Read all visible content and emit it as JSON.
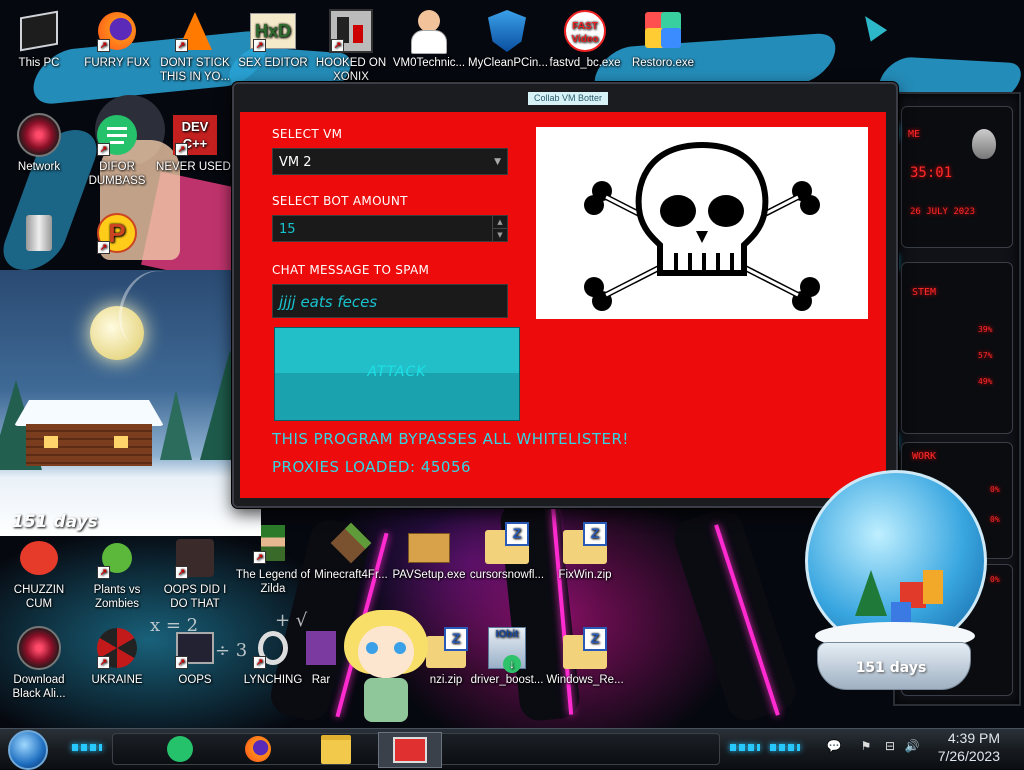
{
  "desktop_icons": [
    {
      "name": "icon-this-pc",
      "label": "This PC"
    },
    {
      "name": "icon-furry-fux",
      "label": "FURRY FUX"
    },
    {
      "name": "icon-dont-stick",
      "label": "DONT STICK THIS IN YO..."
    },
    {
      "name": "icon-sex-editor",
      "label": "SEX EDITOR"
    },
    {
      "name": "icon-hooked-on-xonix",
      "label": "HOOKED ON XONIX"
    },
    {
      "name": "icon-vm0technic",
      "label": "VM0Technic..."
    },
    {
      "name": "icon-mycleanpc",
      "label": "MyCleanPCin..."
    },
    {
      "name": "icon-fastvd",
      "label": "fastvd_bc.exe"
    },
    {
      "name": "icon-restoro",
      "label": "Restoro.exe"
    },
    {
      "name": "icon-network",
      "label": "Network"
    },
    {
      "name": "icon-difor-dumbass",
      "label": "DIFOR DUMBASS"
    },
    {
      "name": "icon-never-used",
      "label": "NEVER USED!"
    },
    {
      "name": "icon-chuzzin-cum",
      "label": "CHUZZIN CUM"
    },
    {
      "name": "icon-plants-vs-zombies",
      "label": "Plants vs Zombies"
    },
    {
      "name": "icon-oops-did-i",
      "label": "OOPS DID I DO THAT"
    },
    {
      "name": "icon-legend-of-zilda",
      "label": "The Legend of Zilda"
    },
    {
      "name": "icon-minecraft",
      "label": "Minecraft4Fr..."
    },
    {
      "name": "icon-pavsetup",
      "label": "PAVSetup.exe"
    },
    {
      "name": "icon-cursorsnow",
      "label": "cursorsnowfl..."
    },
    {
      "name": "icon-fixwin",
      "label": "FixWin.zip"
    },
    {
      "name": "icon-download-black",
      "label": "Download Black Ali..."
    },
    {
      "name": "icon-ukraine",
      "label": "UKRAINE"
    },
    {
      "name": "icon-oops",
      "label": "OOPS"
    },
    {
      "name": "icon-lynching",
      "label": "LYNCHING"
    },
    {
      "name": "icon-rar",
      "label": "Rar"
    },
    {
      "name": "icon-zip",
      "label": "nzi.zip"
    },
    {
      "name": "icon-driver-booster",
      "label": "driver_boost..."
    },
    {
      "name": "icon-windows-re",
      "label": "Windows_Re..."
    }
  ],
  "window": {
    "title": "Collab VM Botter",
    "select_vm_label": "SELECT VM",
    "select_vm_value": "VM 2",
    "bot_amount_label": "SELECT BOT AMOUNT",
    "bot_amount_value": "15",
    "chat_label": "CHAT MESSAGE TO SPAM",
    "chat_value": "jjjj eats feces",
    "attack_button": "ATTACK",
    "bypass_text": "THIS PROGRAM BYPASSES ALL WHITELISTER!",
    "proxies_text": "PROXIES LOADED: 45056"
  },
  "widgets": {
    "snow_days": "151 days",
    "globe_days": "151 days"
  },
  "gadget": {
    "time": "35:01",
    "date": "26 JULY 2023",
    "system_label": "STEM",
    "cpu_pct": "39%",
    "ram_pct": "57%",
    "disk_pct": "49%",
    "network_label": "WORK",
    "net_up": "0%",
    "net_down": "0%",
    "net_total": "0%"
  },
  "taskbar": {
    "time": "4:39 PM",
    "date": "7/26/2023"
  },
  "colors": {
    "window_red": "#ee0b0b",
    "accent_cyan": "#1de0e6",
    "taskbar_accent": "#27c8ff"
  }
}
